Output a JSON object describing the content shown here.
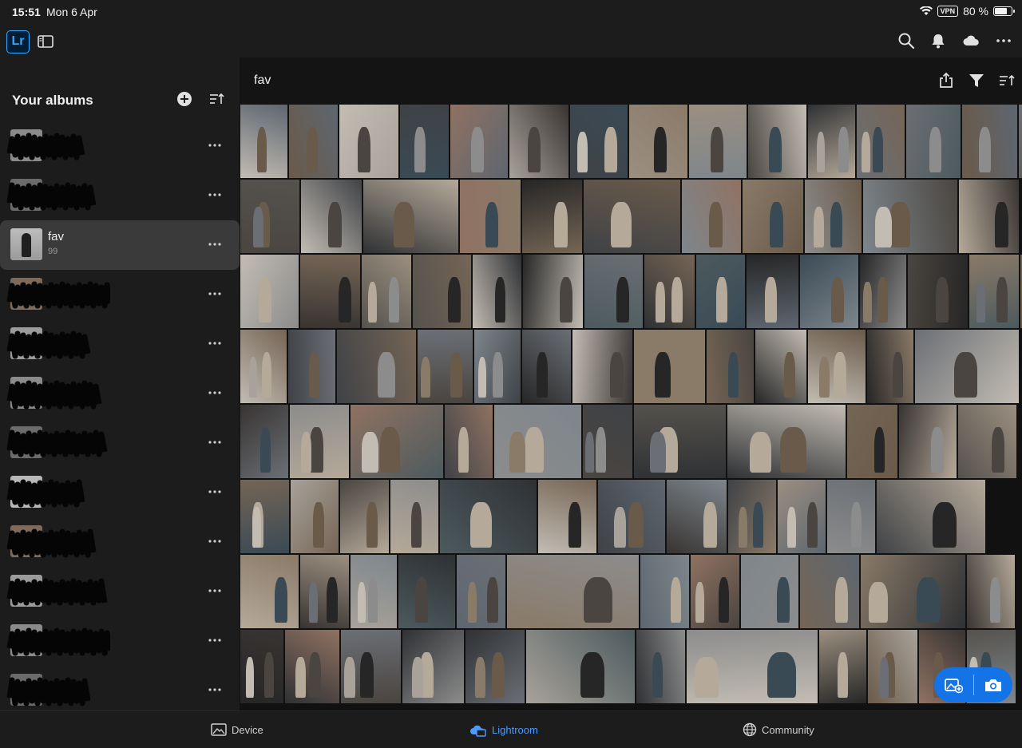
{
  "status": {
    "time": "15:51",
    "date": "Mon 6 Apr",
    "vpn": "VPN",
    "battery": "80 %",
    "battery_level": 0.8
  },
  "appbar": {
    "logo": "Lr",
    "icons": [
      "sidebar-icon",
      "search-icon",
      "bell-icon",
      "cloud-icon",
      "more-icon"
    ]
  },
  "sidebar": {
    "title": "Your albums",
    "albums": [
      {
        "name": "",
        "count": "",
        "redacted": true
      },
      {
        "name": "",
        "count": "",
        "redacted": true
      },
      {
        "name": "fav",
        "count": "99",
        "redacted": false,
        "selected": true
      },
      {
        "name": "",
        "count": "",
        "redacted": true
      },
      {
        "name": "",
        "count": "",
        "redacted": true
      },
      {
        "name": "",
        "count": "",
        "redacted": true
      },
      {
        "name": "",
        "count": "",
        "redacted": true
      },
      {
        "name": "",
        "count": "",
        "redacted": true
      },
      {
        "name": "",
        "count": "",
        "redacted": true
      },
      {
        "name": "",
        "count": "",
        "redacted": true
      },
      {
        "name": "",
        "count": "",
        "redacted": true
      },
      {
        "name": "",
        "count": "",
        "redacted": true
      }
    ]
  },
  "main": {
    "title": "fav",
    "icons": [
      "share-icon",
      "filter-icon",
      "sort-icon"
    ]
  },
  "grid": {
    "palette": [
      "#6b6f75",
      "#3f4246",
      "#8a7a68",
      "#55524d",
      "#a8a29a",
      "#2f3134",
      "#756555",
      "#4c5a5e",
      "#907262",
      "#c2bcb3",
      "#383432",
      "#5e6670",
      "#7e868c",
      "#9b8f80",
      "#262626",
      "#b5a999",
      "#4a4540",
      "#6a5a4a",
      "#3a4a55",
      "#8c8c8c"
    ],
    "rows": [
      [
        61,
        63,
        76,
        63,
        74,
        76,
        74,
        75,
        74,
        75,
        61,
        62,
        70,
        71,
        55
      ],
      [
        76,
        78,
        121,
        78,
        77,
        123,
        76,
        78,
        73,
        120,
        77
      ],
      [
        75,
        77,
        64,
        75,
        63,
        77,
        75,
        65,
        63,
        67,
        75,
        60,
        77,
        64,
        64,
        43
      ],
      [
        60,
        61,
        101,
        71,
        60,
        63,
        77,
        91,
        61,
        66,
        74,
        60,
        132
      ],
      [
        62,
        76,
        118,
        62,
        111,
        64,
        117,
        150,
        65,
        74,
        75
      ],
      [
        63,
        62,
        63,
        62,
        123,
        75,
        86,
        77,
        62,
        62,
        62,
        138
      ],
      [
        75,
        63,
        60,
        73,
        63,
        167,
        63,
        63,
        74,
        76,
        133,
        62
      ],
      [
        56,
        70,
        77,
        79,
        76,
        138,
        63,
        166,
        61,
        64,
        60,
        63
      ]
    ],
    "row_height": 94
  },
  "fab": {
    "icons": [
      "add-photo-icon",
      "camera-icon"
    ]
  },
  "bottomnav": {
    "items": [
      {
        "label": "Device",
        "icon": "device-icon",
        "active": false
      },
      {
        "label": "Lightroom",
        "icon": "lightroom-cloud-icon",
        "active": true
      },
      {
        "label": "Community",
        "icon": "globe-icon",
        "active": false
      }
    ]
  }
}
